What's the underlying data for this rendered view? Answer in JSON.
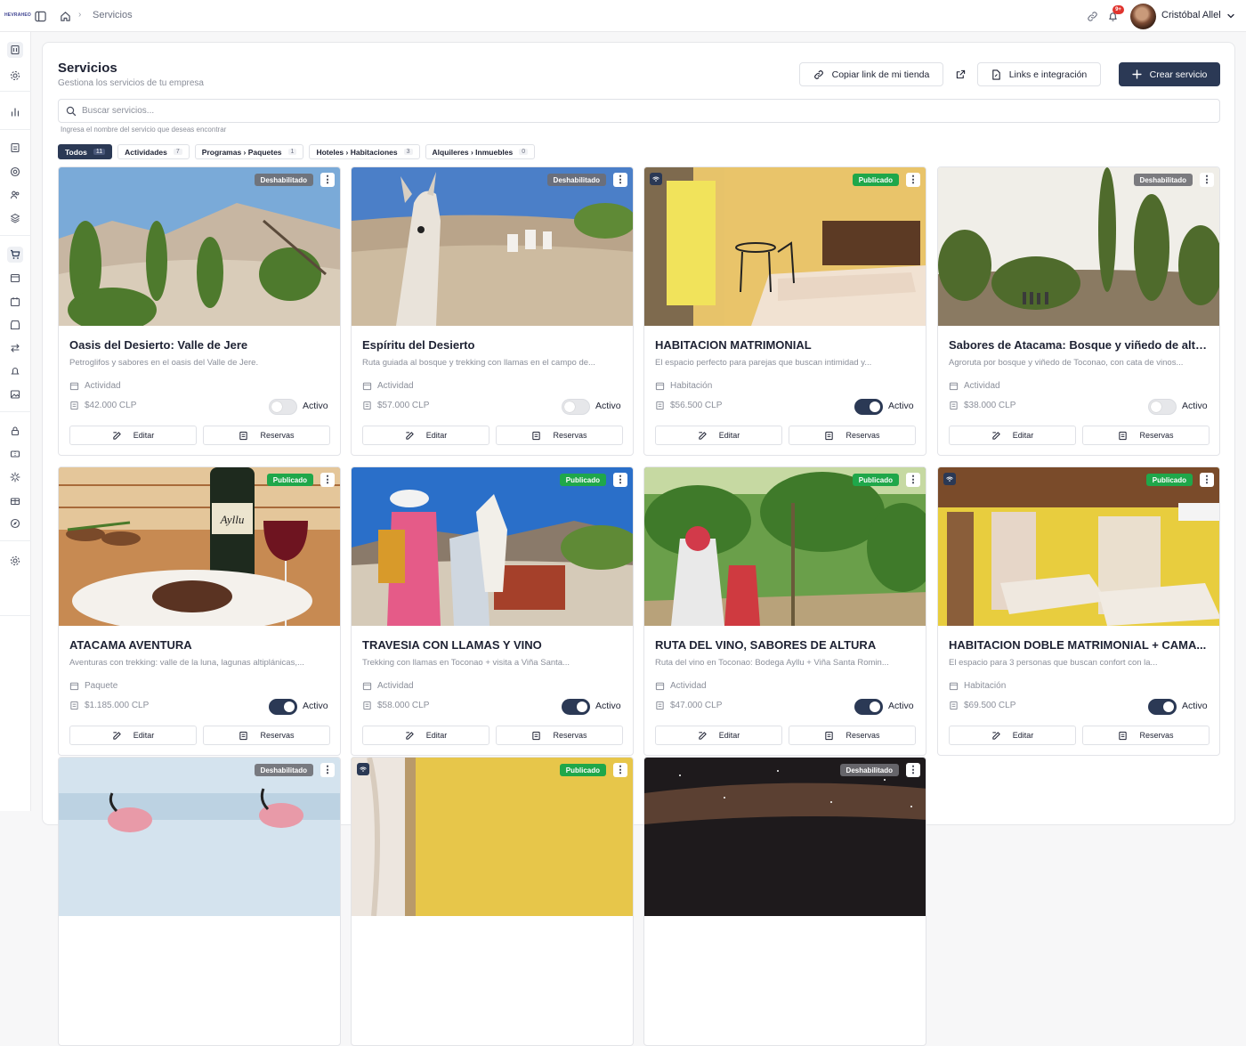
{
  "app": {
    "logo_text": "HEVRAHEO"
  },
  "topbar": {
    "breadcrumb": "Servicios",
    "notifications_badge": "9+",
    "username": "Cristóbal Allel"
  },
  "page": {
    "title": "Servicios",
    "subtitle": "Gestiona los servicios de tu empresa"
  },
  "actions": {
    "copy_link": "Copiar link de mi tienda",
    "links": "Links e integración",
    "create": "Crear servicio"
  },
  "search": {
    "placeholder": "Buscar servicios...",
    "value": "",
    "help": "Ingresa el nombre del servicio que deseas encontrar"
  },
  "filters": [
    {
      "label": "Todos",
      "count": "11",
      "active": true
    },
    {
      "label": "Actividades",
      "count": "7",
      "active": false
    },
    {
      "label": "Programas › Paquetes",
      "count": "1",
      "active": false
    },
    {
      "label": "Hoteles › Habitaciones",
      "count": "3",
      "active": false
    },
    {
      "label": "Alquileres › Inmuebles",
      "count": "0",
      "active": false
    }
  ],
  "card_labels": {
    "edit": "Editar",
    "bookings": "Reservas",
    "active": "Activo"
  },
  "services": [
    {
      "title": "Oasis del Desierto: Valle de Jere",
      "description": "Petroglifos y sabores en el oasis del Valle de Jere.",
      "type": "Actividad",
      "price": "$42.000 CLP",
      "status": "Deshabilitado",
      "active": false,
      "wifi": false,
      "scene": "valley"
    },
    {
      "title": "Espíritu del Desierto",
      "description": "Ruta guiada al bosque y trekking con llamas en el campo de...",
      "type": "Actividad",
      "price": "$57.000 CLP",
      "status": "Deshabilitado",
      "active": false,
      "wifi": false,
      "scene": "llama"
    },
    {
      "title": "HABITACION MATRIMONIAL",
      "description": "El espacio perfecto para parejas que buscan intimidad y...",
      "type": "Habitación",
      "price": "$56.500 CLP",
      "status": "Publicado",
      "active": true,
      "wifi": true,
      "scene": "bedroom"
    },
    {
      "title": "Sabores de Atacama: Bosque y viñedo de altura",
      "description": "Agroruta por bosque y viñedo de Toconao, con cata de vinos...",
      "type": "Actividad",
      "price": "$38.000 CLP",
      "status": "Deshabilitado",
      "active": false,
      "wifi": false,
      "scene": "forest"
    },
    {
      "title": "ATACAMA AVENTURA",
      "description": "Aventuras con trekking: valle de la luna, lagunas altiplánicas,...",
      "type": "Paquete",
      "price": "$1.185.000 CLP",
      "status": "Publicado",
      "active": true,
      "wifi": false,
      "scene": "food",
      "img_text": "Ayllu"
    },
    {
      "title": "TRAVESIA CON LLAMAS Y VINO",
      "description": "Trekking con llamas en Toconao + visita a Viña Santa...",
      "type": "Actividad",
      "price": "$58.000 CLP",
      "status": "Publicado",
      "active": true,
      "wifi": false,
      "scene": "trek"
    },
    {
      "title": "RUTA DEL VINO, SABORES DE ALTURA",
      "description": "Ruta del vino en Toconao: Bodega Ayllu + Viña Santa Romin...",
      "type": "Actividad",
      "price": "$47.000 CLP",
      "status": "Publicado",
      "active": true,
      "wifi": false,
      "scene": "vineyard"
    },
    {
      "title": "HABITACION DOBLE MATRIMONIAL + CAMA...",
      "description": "El espacio para 3 personas que buscan confort con la...",
      "type": "Habitación",
      "price": "$69.500 CLP",
      "status": "Publicado",
      "active": true,
      "wifi": true,
      "scene": "room2"
    },
    {
      "title": "",
      "description": "",
      "type": "",
      "price": "",
      "status": "Deshabilitado",
      "active": false,
      "wifi": false,
      "scene": "flamingo"
    },
    {
      "title": "",
      "description": "",
      "type": "",
      "price": "",
      "status": "Publicado",
      "active": false,
      "wifi": true,
      "scene": "curtain"
    },
    {
      "title": "",
      "description": "",
      "type": "",
      "price": "",
      "status": "Deshabilitado",
      "active": false,
      "wifi": false,
      "scene": "night"
    }
  ]
}
